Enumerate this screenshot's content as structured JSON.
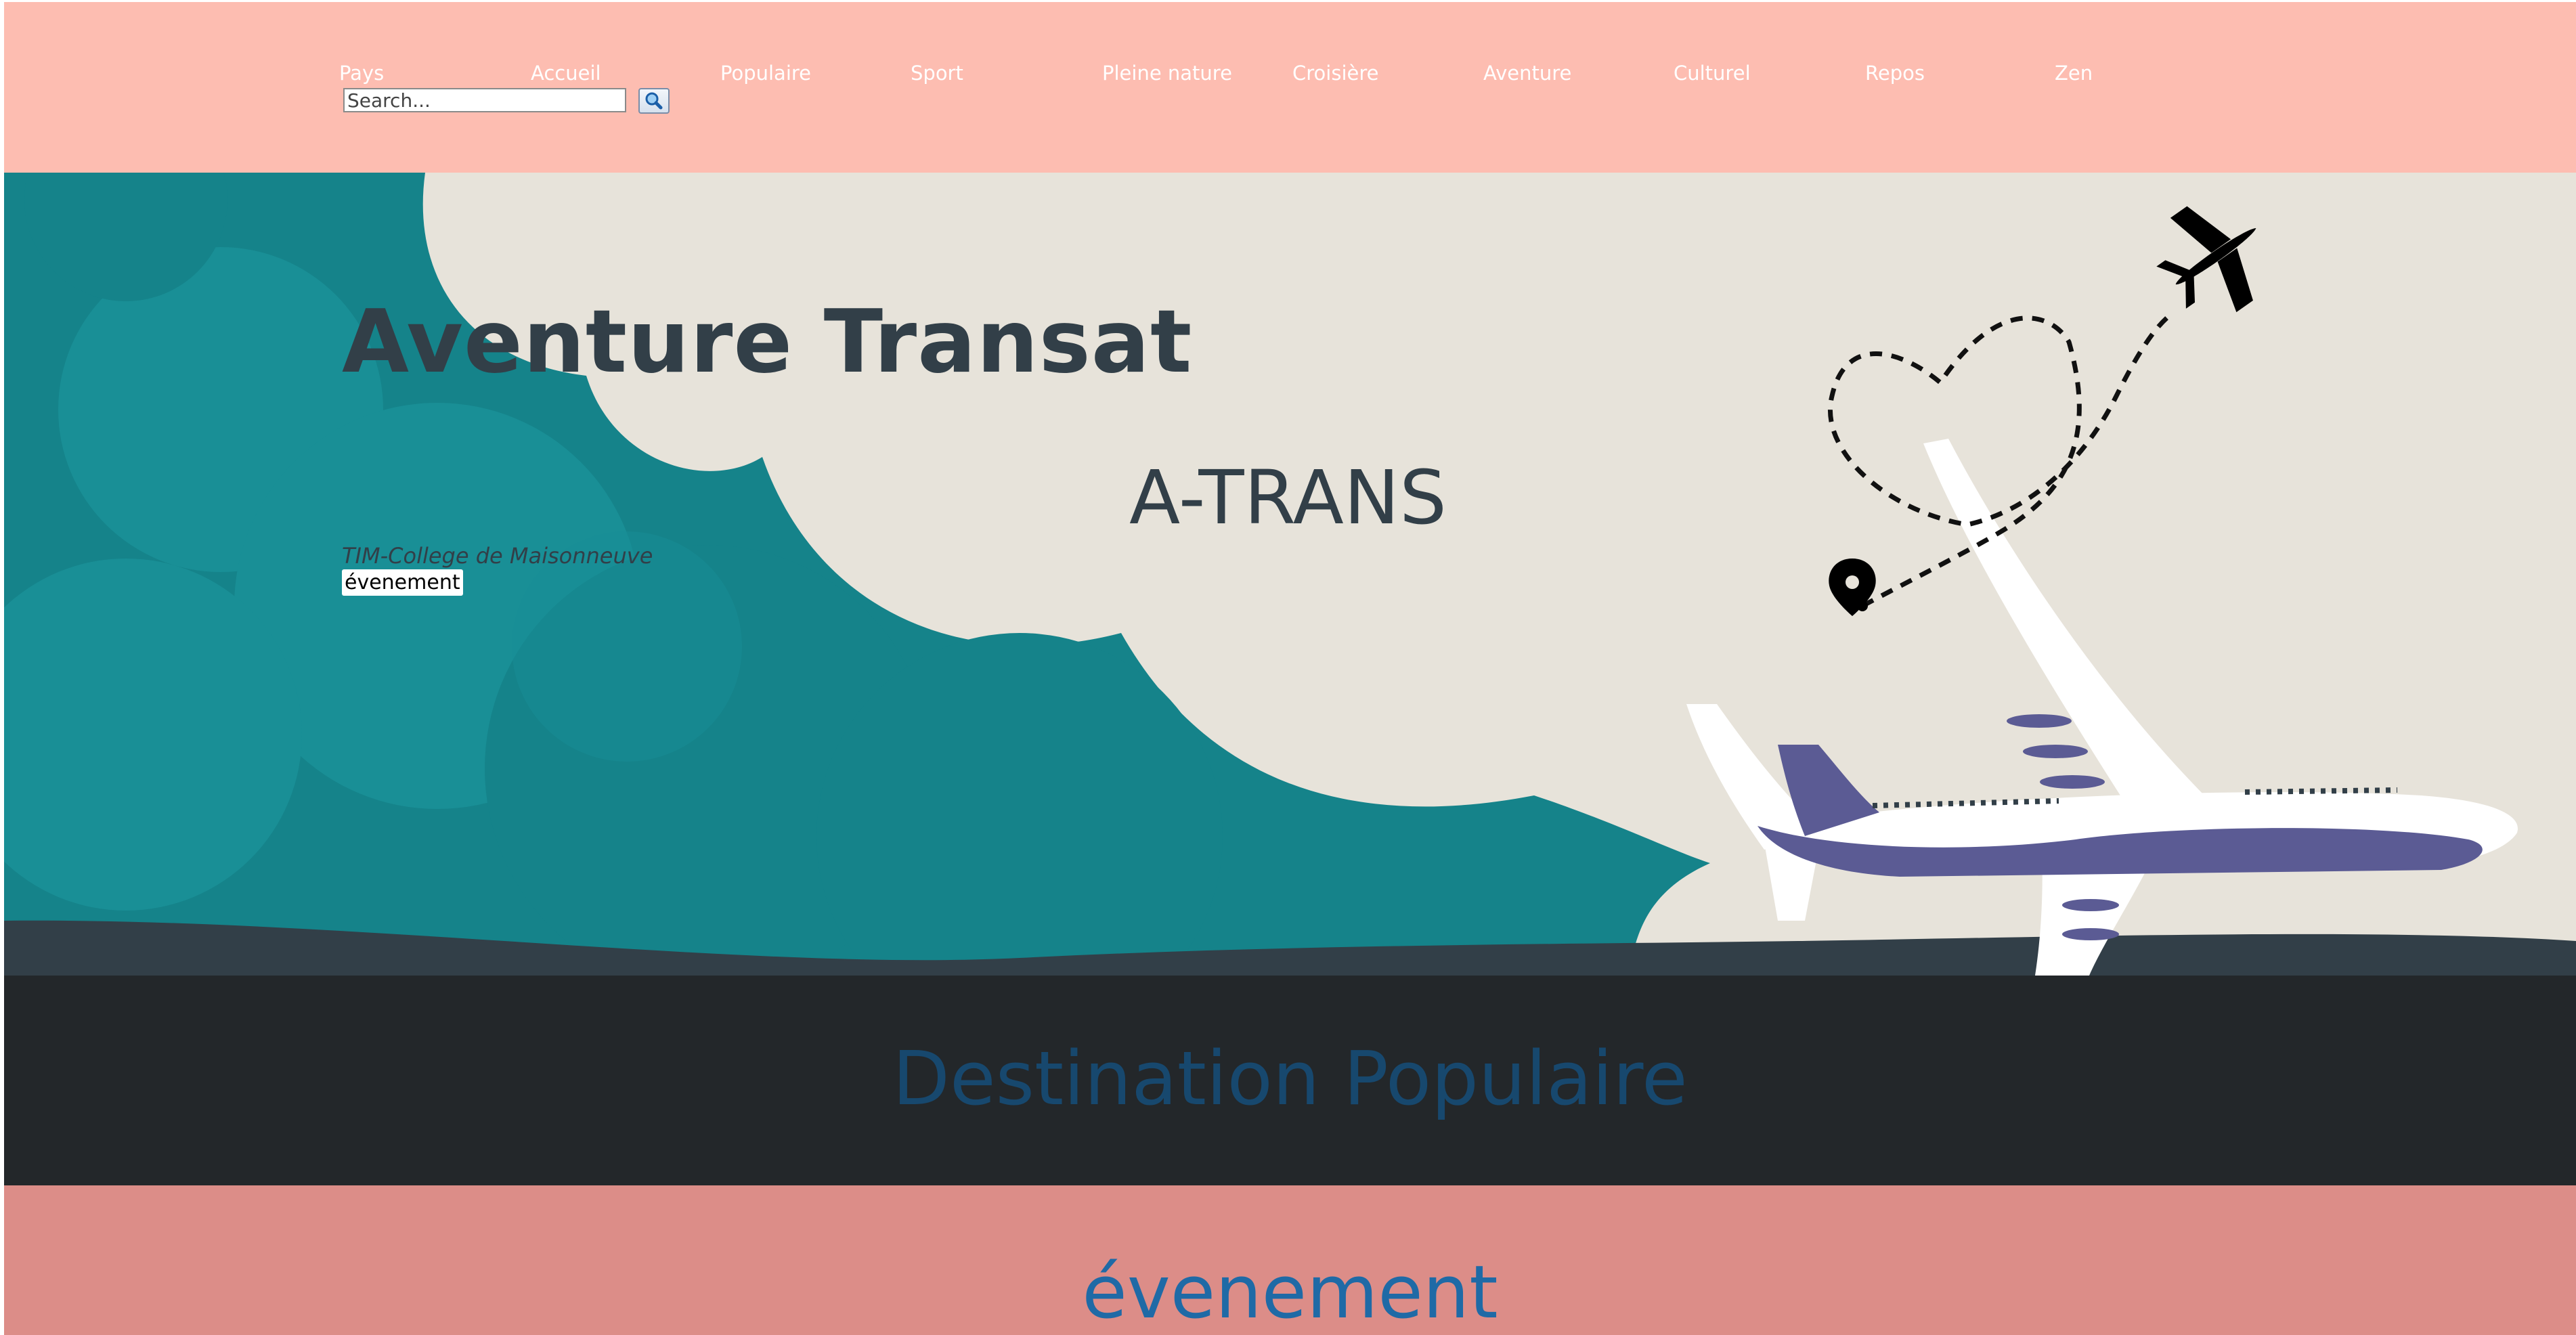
{
  "nav": {
    "items": [
      {
        "label": "Pays"
      },
      {
        "label": "Accueil"
      },
      {
        "label": "Populaire"
      },
      {
        "label": "Sport"
      },
      {
        "label": "Pleine nature"
      },
      {
        "label": "Croisière"
      },
      {
        "label": "Aventure"
      },
      {
        "label": "Culturel"
      },
      {
        "label": "Repos"
      },
      {
        "label": "Zen"
      }
    ]
  },
  "search": {
    "placeholder": "Search...",
    "button_icon": "magnifier-icon"
  },
  "hero": {
    "title": "Aventure Transat",
    "brand": "A-TRANS",
    "college": "TIM-College de Maisonneuve",
    "event_button": "évenement"
  },
  "sections": {
    "destination_title": "Destination Populaire",
    "event_title": "évenement"
  },
  "colors": {
    "header_bg": "#fdbdb1",
    "hero_bg": "#e7e3da",
    "teal_cloud": "#15838a",
    "plane_body": "#5b5b94",
    "dark_section": "#23272a",
    "destination_text": "#17486e",
    "event_section": "#dc8d88",
    "event_text": "#1f6aa6",
    "title_text": "#323f48"
  }
}
